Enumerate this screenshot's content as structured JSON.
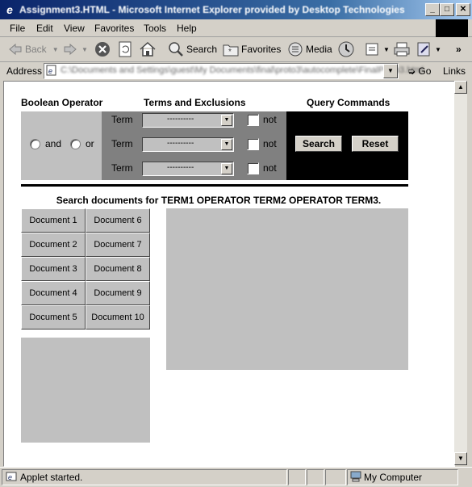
{
  "window": {
    "title": "Assignment3.HTML - Microsoft Internet Explorer provided by Desktop Technologies"
  },
  "menu": [
    "File",
    "Edit",
    "View",
    "Favorites",
    "Tools",
    "Help"
  ],
  "toolbar": {
    "back": "Back",
    "search": "Search",
    "favorites": "Favorites",
    "media": "Media"
  },
  "address": {
    "label": "Address",
    "value": "C:\\Documents and Settings\\guest\\My Documents\\final\\proto3\\autocomplete\\FinalProto3.html",
    "go": "Go",
    "links": "Links"
  },
  "applet": {
    "headers": {
      "operator": "Boolean Operator",
      "terms": "Terms and Exclusions",
      "commands": "Query Commands"
    },
    "operators": [
      "and",
      "or"
    ],
    "terms": [
      {
        "label": "Term",
        "value": "----------",
        "not": "not"
      },
      {
        "label": "Term",
        "value": "----------",
        "not": "not"
      },
      {
        "label": "Term",
        "value": "----------",
        "not": "not"
      }
    ],
    "buttons": {
      "search": "Search",
      "reset": "Reset"
    },
    "search_description": "Search documents for TERM1 OPERATOR TERM2 OPERATOR TERM3.",
    "documents": [
      "Document 1",
      "Document 6",
      "Document 2",
      "Document 7",
      "Document 3",
      "Document 8",
      "Document 4",
      "Document 9",
      "Document 5",
      "Document 10"
    ]
  },
  "status": {
    "text": "Applet started.",
    "zone": "My Computer"
  }
}
